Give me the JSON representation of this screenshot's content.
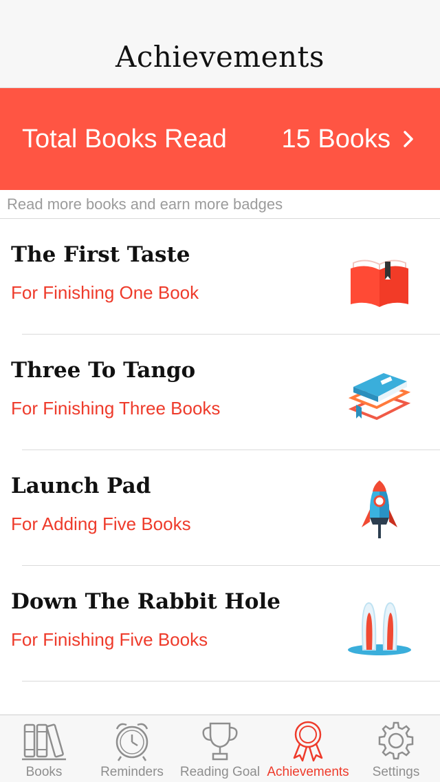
{
  "header": {
    "title": "Achievements"
  },
  "summary": {
    "label": "Total Books Read",
    "count": "15 Books"
  },
  "hint": "Read more books and earn more badges",
  "achievements": [
    {
      "name": "The First Taste",
      "description": "For Finishing One Book",
      "icon": "open-book-icon"
    },
    {
      "name": "Three To Tango",
      "description": "For Finishing Three Books",
      "icon": "book-stack-icon"
    },
    {
      "name": "Launch Pad",
      "description": "For Adding Five Books",
      "icon": "rocket-icon"
    },
    {
      "name": "Down The Rabbit Hole",
      "description": "For Finishing Five Books",
      "icon": "rabbit-ears-icon"
    }
  ],
  "tabs": [
    {
      "label": "Books",
      "icon": "books-icon",
      "active": false
    },
    {
      "label": "Reminders",
      "icon": "alarm-clock-icon",
      "active": false
    },
    {
      "label": "Reading Goal",
      "icon": "trophy-icon",
      "active": false
    },
    {
      "label": "Achievements",
      "icon": "ribbon-badge-icon",
      "active": true
    },
    {
      "label": "Settings",
      "icon": "gear-icon",
      "active": false
    }
  ],
  "colors": {
    "accent": "#ff5543",
    "accent_text": "#ee3b2b",
    "tab_inactive": "#8e8e8e"
  }
}
